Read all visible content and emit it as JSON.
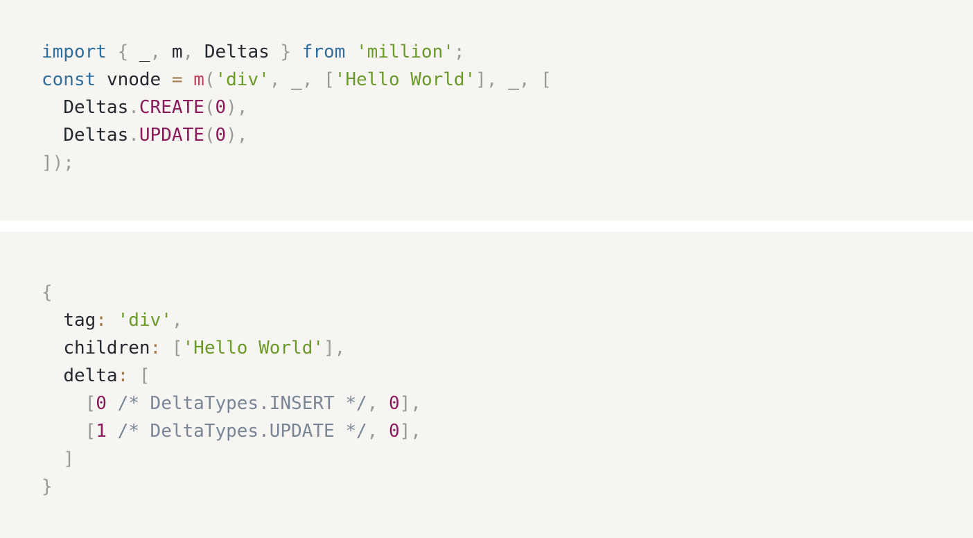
{
  "block1": {
    "l1": {
      "import": "import",
      "ob": "{",
      "u": "_",
      "c1": ",",
      "m": "m",
      "c2": ",",
      "deltas": "Deltas",
      "cb": "}",
      "from": "from",
      "mod": "'million'",
      "semi": ";"
    },
    "l2": {
      "const": "const",
      "vnode": "vnode",
      "eq": "=",
      "m": "m",
      "op": "(",
      "div": "'div'",
      "c1": ",",
      "u1": "_",
      "c2": ",",
      "ob": "[",
      "hello": "'Hello World'",
      "cb": "]",
      "c3": ",",
      "u2": "_",
      "c4": ",",
      "ob2": "["
    },
    "l3": {
      "deltas": "Deltas",
      "dot": ".",
      "create": "CREATE",
      "op": "(",
      "zero": "0",
      "cp": ")",
      "comma": ","
    },
    "l4": {
      "deltas": "Deltas",
      "dot": ".",
      "update": "UPDATE",
      "op": "(",
      "zero": "0",
      "cp": ")",
      "comma": ","
    },
    "l5": {
      "close": "]);"
    }
  },
  "block2": {
    "l1": {
      "ob": "{"
    },
    "l2": {
      "tag": "tag",
      "colon": ":",
      "val": "'div'",
      "comma": ","
    },
    "l3": {
      "children": "children",
      "colon": ":",
      "ob": "[",
      "hello": "'Hello World'",
      "cb": "]",
      "comma": ","
    },
    "l4": {
      "delta": "delta",
      "colon": ":",
      "ob": "["
    },
    "l5": {
      "ob": "[",
      "n": "0",
      "comment": "/* DeltaTypes.INSERT */",
      "comma": ",",
      "n2": "0",
      "cb": "]",
      "comma2": ","
    },
    "l6": {
      "ob": "[",
      "n": "1",
      "comment": "/* DeltaTypes.UPDATE */",
      "comma": ",",
      "n2": "0",
      "cb": "]",
      "comma2": ","
    },
    "l7": {
      "cb": "]"
    },
    "l8": {
      "cb": "}"
    }
  }
}
